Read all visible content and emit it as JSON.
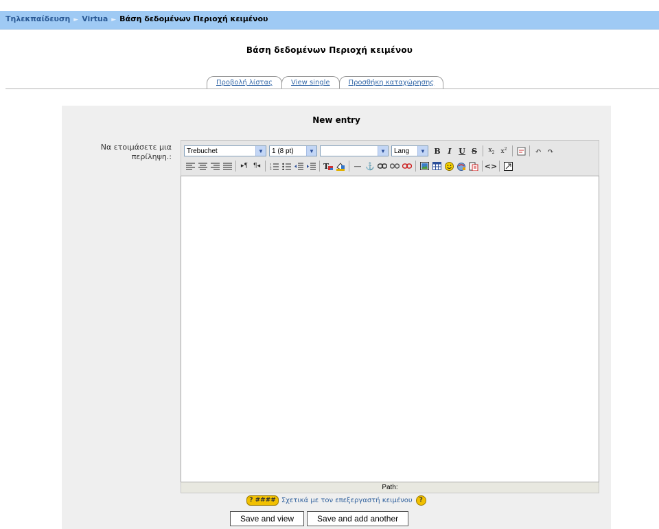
{
  "breadcrumb": {
    "items": [
      "Τηλεκπαίδευση",
      "Virtua"
    ],
    "current": "Βάση δεδομένων Περιοχή κειμένου",
    "separator": "►"
  },
  "page_title": "Βάση δεδομένων Περιοχή κειμένου",
  "tabs": [
    {
      "label": "Προβολή λίστας"
    },
    {
      "label": "View single"
    },
    {
      "label": "Προσθήκη καταχώρησης"
    }
  ],
  "form": {
    "title": "New entry",
    "field_label": "Να ετοιμάσετε μια περίληψη.:",
    "editor": {
      "font_select": "Trebuchet",
      "size_select": "1 (8 pt)",
      "heading_select": "",
      "lang_select": "Lang",
      "path_label": "Path:",
      "content": ""
    },
    "help_badge": "? ####",
    "help_link": "Σχετικά με τον επεξεργαστή κειμένου",
    "help_q": "?",
    "buttons": {
      "save_view": "Save and view",
      "save_add": "Save and add another"
    }
  },
  "colors": {
    "navbar_bg": "#9fcaf4",
    "link": "#2b5a95",
    "panel_bg": "#efefef"
  }
}
